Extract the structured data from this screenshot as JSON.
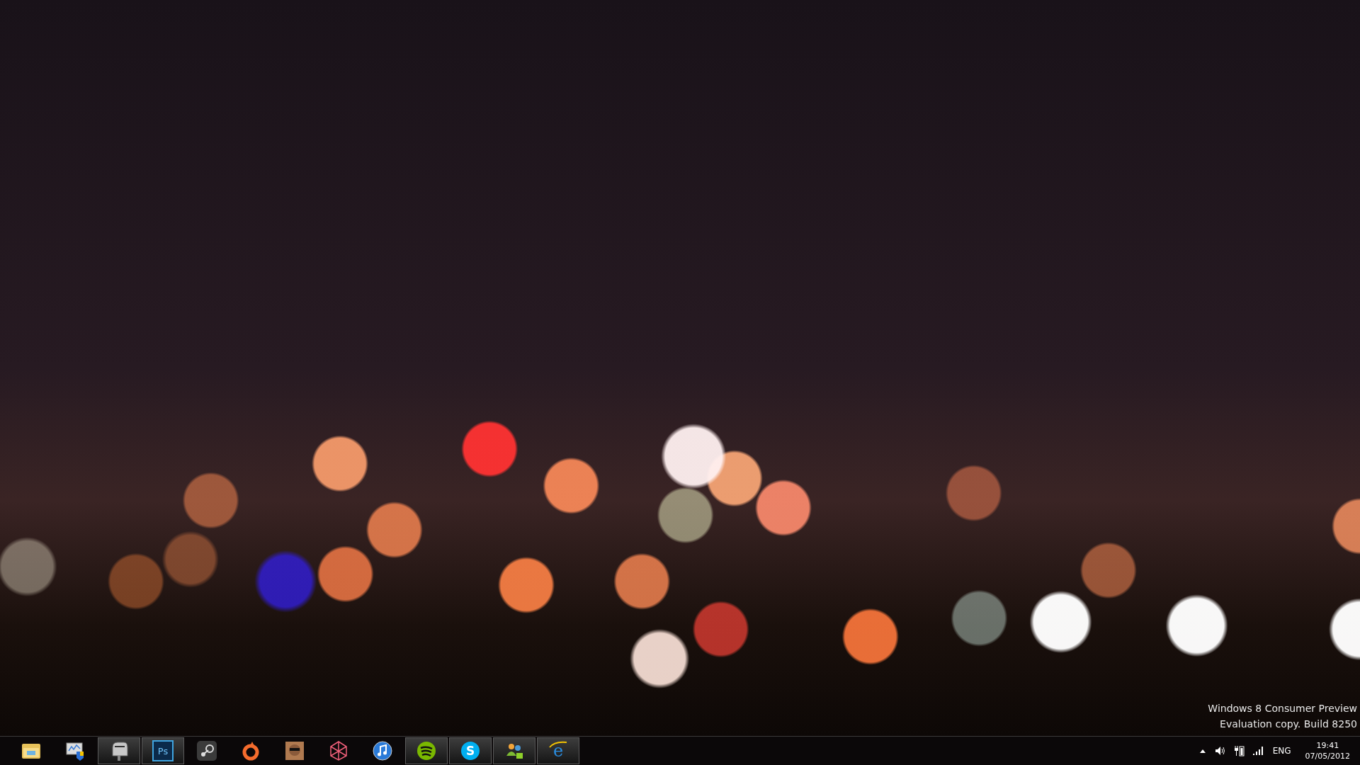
{
  "desktop": {
    "watermark": [
      "Windows 8 Consumer Preview",
      "Evaluation copy. Build 8250"
    ]
  },
  "taskbar": {
    "items": [
      {
        "kind": "folder",
        "running": false
      },
      {
        "kind": "action-center",
        "running": false
      },
      {
        "kind": "mailbox",
        "running": true
      },
      {
        "kind": "photoshop",
        "running": true,
        "glyph": "Ps"
      },
      {
        "kind": "steam",
        "running": false
      },
      {
        "kind": "origin",
        "running": false
      },
      {
        "kind": "game",
        "running": false
      },
      {
        "kind": "zune",
        "running": false
      },
      {
        "kind": "itunes",
        "running": false
      },
      {
        "kind": "spotify",
        "running": true
      },
      {
        "kind": "skype",
        "running": true,
        "glyph": "S"
      },
      {
        "kind": "messenger",
        "running": true
      },
      {
        "kind": "ie",
        "running": true,
        "glyph": "e"
      }
    ]
  },
  "tray": {
    "language": "ENG",
    "time": "19:41",
    "date": "07/05/2012"
  }
}
